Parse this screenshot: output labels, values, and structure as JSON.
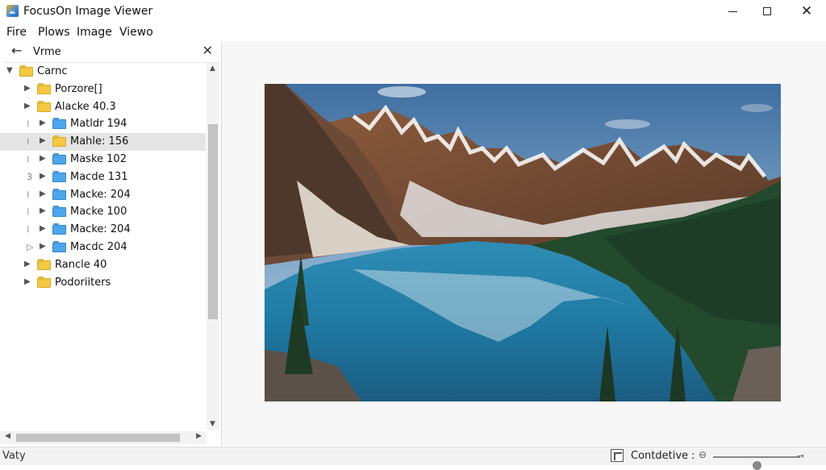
{
  "window": {
    "title": "FocusOn Image Viewer",
    "controls": {
      "minimize_icon": "minimize-icon",
      "maximize_icon": "maximize-icon",
      "close_icon": "close-icon",
      "close_glyph": "✕"
    }
  },
  "menu": {
    "items": [
      {
        "label": "Fire"
      },
      {
        "label": "Plows"
      },
      {
        "label": "Image"
      },
      {
        "label": "Viewo"
      }
    ]
  },
  "sidebar": {
    "back_glyph": "←",
    "header_label": "Vrme",
    "close_glyph": "✕",
    "tree": [
      {
        "label": "Carnc",
        "color": "yellow",
        "level": 0,
        "expanded": true,
        "selected": false,
        "guide": ""
      },
      {
        "label": "Porzore[]",
        "color": "yellow",
        "level": 1,
        "expanded": false,
        "selected": false,
        "guide": ""
      },
      {
        "label": "Alacke 40.3",
        "color": "yellow",
        "level": 1,
        "expanded": false,
        "selected": false,
        "guide": ""
      },
      {
        "label": "Matldr 194",
        "color": "blue",
        "level": 2,
        "expanded": false,
        "selected": false,
        "guide": "⁞"
      },
      {
        "label": "Mahle: 156",
        "color": "yellow",
        "level": 2,
        "expanded": false,
        "selected": true,
        "guide": "⁞"
      },
      {
        "label": "Maske 102",
        "color": "blue",
        "level": 2,
        "expanded": false,
        "selected": false,
        "guide": "⁞"
      },
      {
        "label": "Macde 131",
        "color": "blue",
        "level": 2,
        "expanded": false,
        "selected": false,
        "guide": "3"
      },
      {
        "label": "Macke: 204",
        "color": "blue",
        "level": 2,
        "expanded": false,
        "selected": false,
        "guide": "⁞"
      },
      {
        "label": "Macke 100",
        "color": "blue",
        "level": 2,
        "expanded": false,
        "selected": false,
        "guide": "⁞"
      },
      {
        "label": "Macke: 204",
        "color": "blue",
        "level": 2,
        "expanded": false,
        "selected": false,
        "guide": "⁞"
      },
      {
        "label": "Macdc 204",
        "color": "blue",
        "level": 2,
        "expanded": false,
        "selected": false,
        "guide": "▷"
      },
      {
        "label": "Rancle 40",
        "color": "yellow",
        "level": 1,
        "expanded": false,
        "selected": false,
        "guide": ""
      },
      {
        "label": "Podoriiters",
        "color": "yellow",
        "level": 1,
        "expanded": false,
        "selected": false,
        "guide": ""
      }
    ]
  },
  "viewer": {
    "image_subject": "mountain-lake-photo"
  },
  "statusbar": {
    "left_text": "Vaty",
    "mode_label": "Contdetive :",
    "fit_icon": "fit-to-window-icon",
    "zoom_icon": "zoom-out-icon",
    "zoom_level": 0.5
  },
  "colors": {
    "folder_yellow": "#f5c842",
    "folder_blue": "#4ea6ea",
    "selection": "#e5e5e5"
  }
}
